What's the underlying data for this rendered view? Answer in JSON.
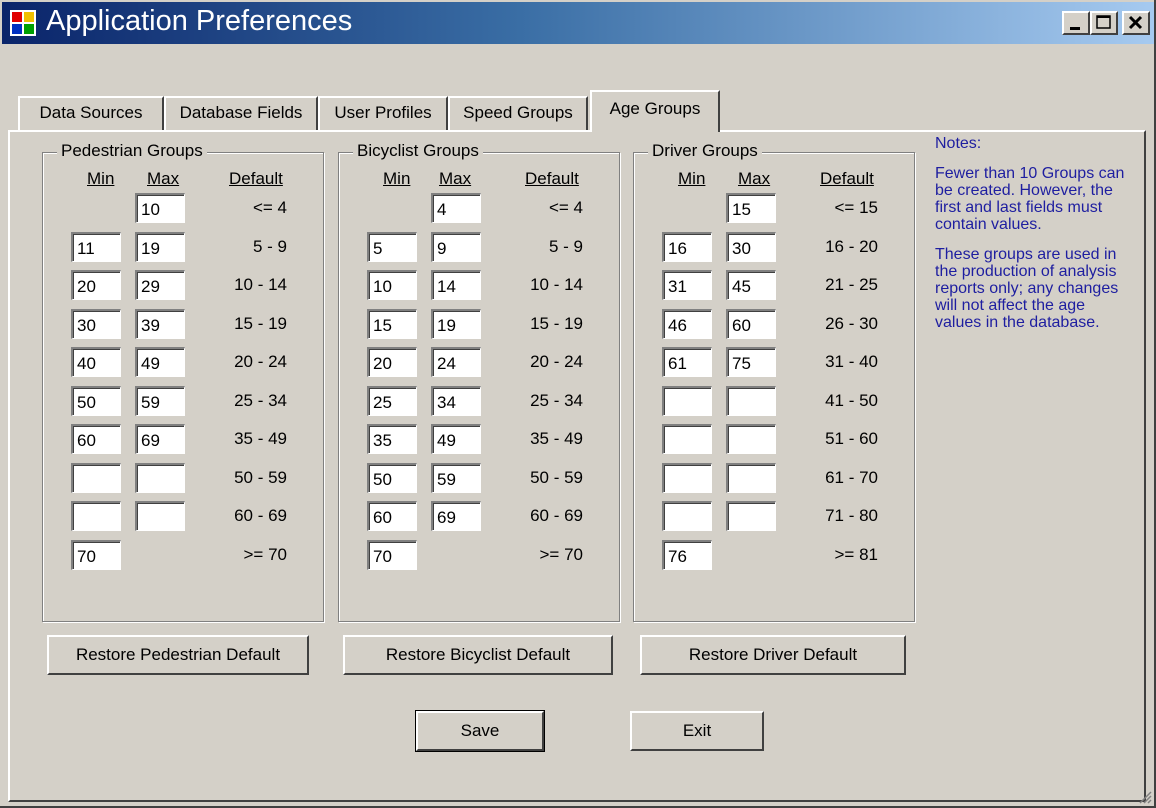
{
  "window": {
    "title": "Application Preferences"
  },
  "tabs": [
    "Data Sources",
    "Database Fields",
    "User Profiles",
    "Speed Groups",
    "Age Groups"
  ],
  "active_tab": "Age Groups",
  "columns": {
    "min": "Min",
    "max": "Max",
    "default": "Default"
  },
  "pedestrian": {
    "title": "Pedestrian Groups",
    "rows": [
      {
        "min": null,
        "max": "10",
        "default": "<= 4"
      },
      {
        "min": "11",
        "max": "19",
        "default": "5 - 9"
      },
      {
        "min": "20",
        "max": "29",
        "default": "10 - 14"
      },
      {
        "min": "30",
        "max": "39",
        "default": "15 - 19"
      },
      {
        "min": "40",
        "max": "49",
        "default": "20 - 24"
      },
      {
        "min": "50",
        "max": "59",
        "default": "25 - 34"
      },
      {
        "min": "60",
        "max": "69",
        "default": "35 - 49"
      },
      {
        "min": "",
        "max": "",
        "default": "50 - 59"
      },
      {
        "min": "",
        "max": "",
        "default": "60 - 69"
      },
      {
        "min": "70",
        "max": null,
        "default": ">= 70"
      }
    ],
    "restore_label": "Restore Pedestrian Default"
  },
  "bicyclist": {
    "title": "Bicyclist Groups",
    "rows": [
      {
        "min": null,
        "max": "4",
        "default": "<= 4"
      },
      {
        "min": "5",
        "max": "9",
        "default": "5 - 9"
      },
      {
        "min": "10",
        "max": "14",
        "default": "10 - 14"
      },
      {
        "min": "15",
        "max": "19",
        "default": "15 - 19"
      },
      {
        "min": "20",
        "max": "24",
        "default": "20 - 24"
      },
      {
        "min": "25",
        "max": "34",
        "default": "25 - 34"
      },
      {
        "min": "35",
        "max": "49",
        "default": "35 - 49"
      },
      {
        "min": "50",
        "max": "59",
        "default": "50 - 59"
      },
      {
        "min": "60",
        "max": "69",
        "default": "60 - 69"
      },
      {
        "min": "70",
        "max": null,
        "default": ">= 70"
      }
    ],
    "restore_label": "Restore Bicyclist Default"
  },
  "driver": {
    "title": "Driver Groups",
    "rows": [
      {
        "min": null,
        "max": "15",
        "default": "<= 15"
      },
      {
        "min": "16",
        "max": "30",
        "default": "16 - 20"
      },
      {
        "min": "31",
        "max": "45",
        "default": "21 - 25"
      },
      {
        "min": "46",
        "max": "60",
        "default": "26 - 30"
      },
      {
        "min": "61",
        "max": "75",
        "default": "31 - 40"
      },
      {
        "min": "",
        "max": "",
        "default": "41 - 50"
      },
      {
        "min": "",
        "max": "",
        "default": "51 - 60"
      },
      {
        "min": "",
        "max": "",
        "default": "61 - 70"
      },
      {
        "min": "",
        "max": "",
        "default": "71 - 80"
      },
      {
        "min": "76",
        "max": null,
        "default": ">= 81"
      }
    ],
    "restore_label": "Restore Driver Default"
  },
  "notes": {
    "heading": "Notes:",
    "para1": "Fewer than 10 Groups can be created. However, the first and last fields must contain values.",
    "para2": "These groups are used in the production of analysis reports only; any changes will not affect the age values in the database."
  },
  "buttons": {
    "save": "Save",
    "exit": "Exit"
  },
  "icons": {
    "app": "app-grid-icon",
    "minimize": "minimize-icon",
    "maximize": "maximize-icon",
    "close": "close-icon",
    "grip": "resize-grip-icon"
  },
  "colors": {
    "titlebar_start": "#0a246a",
    "titlebar_end": "#a6caf0",
    "notes_text": "#1e1ea0",
    "face": "#d4d0c8"
  }
}
